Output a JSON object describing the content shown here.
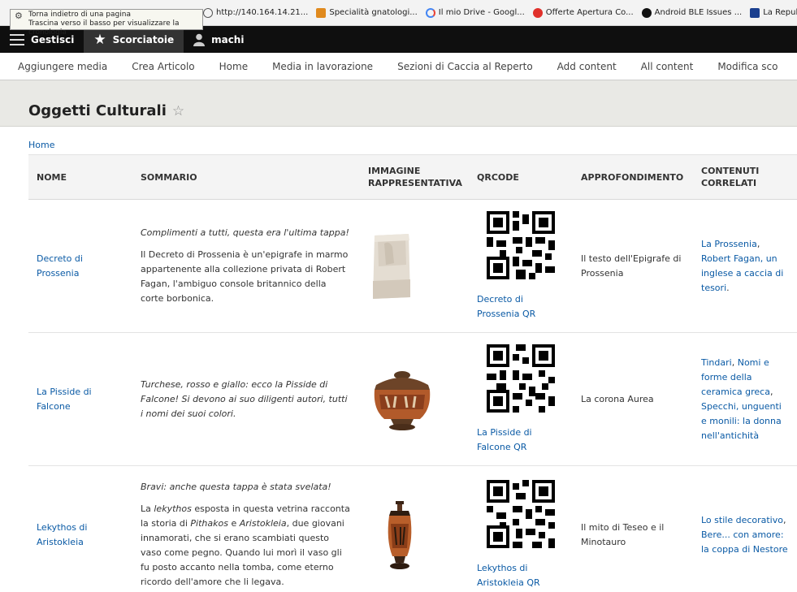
{
  "tooltip": {
    "line1": "Torna indietro di una pagina",
    "line2": "Trascina verso il basso per visualizzare la cronologia"
  },
  "bookmarks": [
    {
      "label": "http://140.164.14.21...",
      "icon": "globe-icon",
      "color": "#555555"
    },
    {
      "label": "Specialità gnatologi...",
      "icon": "mp-icon",
      "color": "#e08a1e"
    },
    {
      "label": "Il mio Drive - Googl...",
      "icon": "google-icon",
      "color": "#4285f4"
    },
    {
      "label": "Offerte Apertura Co...",
      "icon": "offer-icon",
      "color": "#e0302a"
    },
    {
      "label": "Android BLE Issues ...",
      "icon": "github-icon",
      "color": "#111111"
    },
    {
      "label": "La Repubblica.it - N...",
      "icon": "repubblica-icon",
      "color": "#1a3f8f"
    }
  ],
  "toolbar": {
    "manage": "Gestisci",
    "shortcuts": "Scorciatoie",
    "user": "machi"
  },
  "shortcuts": [
    "Aggiungere media",
    "Crea Articolo",
    "Home",
    "Media in lavorazione",
    "Sezioni di Caccia al Reperto",
    "Add content",
    "All content",
    "Modifica sco"
  ],
  "page": {
    "title": "Oggetti Culturali",
    "breadcrumb": "Home"
  },
  "table": {
    "headers": {
      "name": "NOME",
      "summary": "SOMMARIO",
      "image1": "IMMAGINE",
      "image2": "RAPPRESENTATIVA",
      "qrcode": "QRCODE",
      "details": "APPROFONDIMENTO",
      "related1": "CONTENUTI",
      "related2": "CORRELATI"
    },
    "rows": [
      {
        "name": "Decreto di Prossenia",
        "lead": "Complimenti a tutti, questa era l'ultima tappa!",
        "body": "Il Decreto di Prossenia è un'epigrafe in marmo appartenente alla collezione privata di Robert Fagan, l'ambiguo console britannico della corte borbonica.",
        "qr_label": "Decreto di Prossenia QR",
        "details": "Il testo dell'Epigrafe di Prossenia",
        "related": [
          {
            "text": "La Prossenia",
            "link": true
          },
          {
            "text": ", ",
            "link": false
          },
          {
            "text": "Robert Fagan, un inglese a caccia di tesori",
            "link": true
          },
          {
            "text": ".",
            "link": false
          }
        ]
      },
      {
        "name": "La Pisside di Falcone",
        "lead": "Turchese, rosso e giallo: ecco la Pisside di Falcone! Si devono ai suo diligenti autori, tutti i nomi dei suoi colori.",
        "qr_label": "La Pisside di Falcone QR",
        "details": "La corona Aurea",
        "related": [
          {
            "text": "Tindari",
            "link": true
          },
          {
            "text": ", ",
            "link": false
          },
          {
            "text": "Nomi e forme della ceramica greca",
            "link": true
          },
          {
            "text": ", ",
            "link": false
          },
          {
            "text": "Specchi, unguenti e monili: la donna nell'antichità",
            "link": true
          }
        ]
      },
      {
        "name": "Lekythos di Aristokleia",
        "lead": "Bravi: anche questa tappa è stata svelata!",
        "body_parts": [
          {
            "text": "La ",
            "italic": false
          },
          {
            "text": "lekythos",
            "italic": true
          },
          {
            "text": " esposta in questa vetrina racconta la storia di ",
            "italic": false
          },
          {
            "text": "Pithakos",
            "italic": true
          },
          {
            "text": " e ",
            "italic": false
          },
          {
            "text": "Aristokleia",
            "italic": true
          },
          {
            "text": ", due giovani innamorati, che si erano scambiati questo vaso come pegno. Quando lui morì il vaso gli fu posto accanto nella tomba, come eterno ricordo dell'amore che li legava.",
            "italic": false
          }
        ],
        "qr_label": "Lekythos di Aristokleia QR",
        "details": "Il mito di Teseo e il Minotauro",
        "related": [
          {
            "text": "Lo stile decorativo",
            "link": true
          },
          {
            "text": ", ",
            "link": false
          },
          {
            "text": "Bere... con amore: la coppa di Nestore",
            "link": true
          }
        ]
      }
    ]
  },
  "colors": {
    "link": "#0a5aa5",
    "toolbar_bg": "#0f0f0f",
    "header_bg": "#e9e9e5"
  }
}
